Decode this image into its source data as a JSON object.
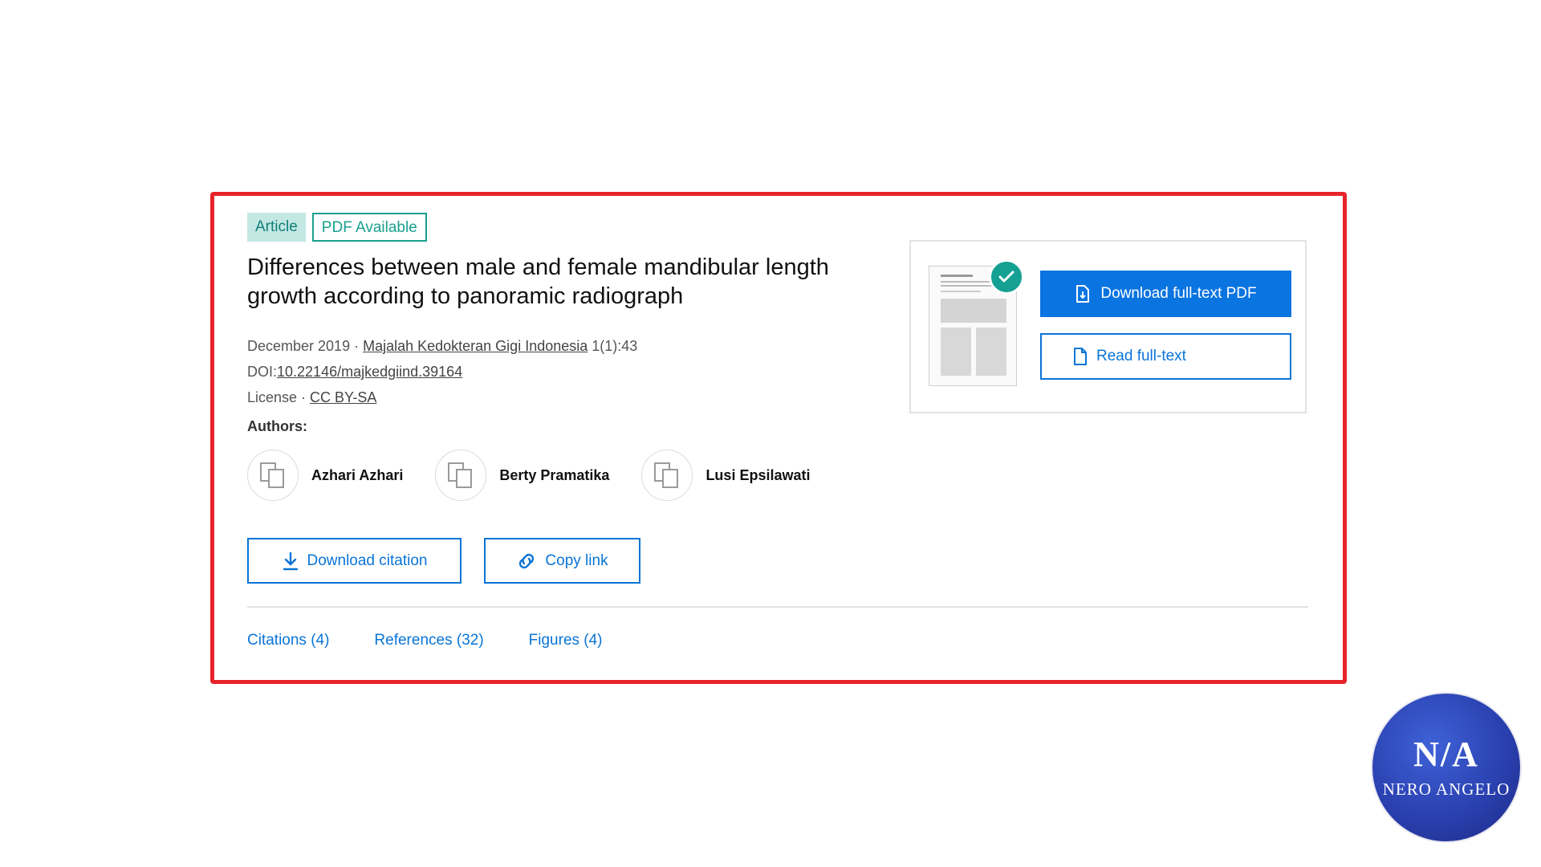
{
  "badges": {
    "type": "Article",
    "pdf": "PDF Available"
  },
  "publication": {
    "title": "Differences between male and female mandibular length growth according to panoramic radiograph",
    "date": "December 2019",
    "separator": " · ",
    "journal": "Majalah Kedokteran Gigi Indonesia",
    "volume": "1(1):43",
    "doi_label": "DOI:",
    "doi": "10.22146/majkedgiind.39164",
    "license_label": "License",
    "license": "CC BY-SA"
  },
  "authors_label": "Authors:",
  "authors": [
    {
      "name": "Azhari Azhari"
    },
    {
      "name": "Berty Pramatika"
    },
    {
      "name": "Lusi Epsilawati"
    }
  ],
  "actions": {
    "download_citation": "Download citation",
    "copy_link": "Copy link"
  },
  "tabs": {
    "citations": "Citations (4)",
    "references": "References (32)",
    "figures": "Figures (4)"
  },
  "pdf_panel": {
    "download": "Download full-text PDF",
    "read": "Read full-text"
  },
  "logo": {
    "mark": "N/A",
    "name": "NERO ANGELO"
  },
  "colors": {
    "highlight": "#e8232a",
    "accent": "#0a74e0",
    "teal": "#14a092"
  }
}
